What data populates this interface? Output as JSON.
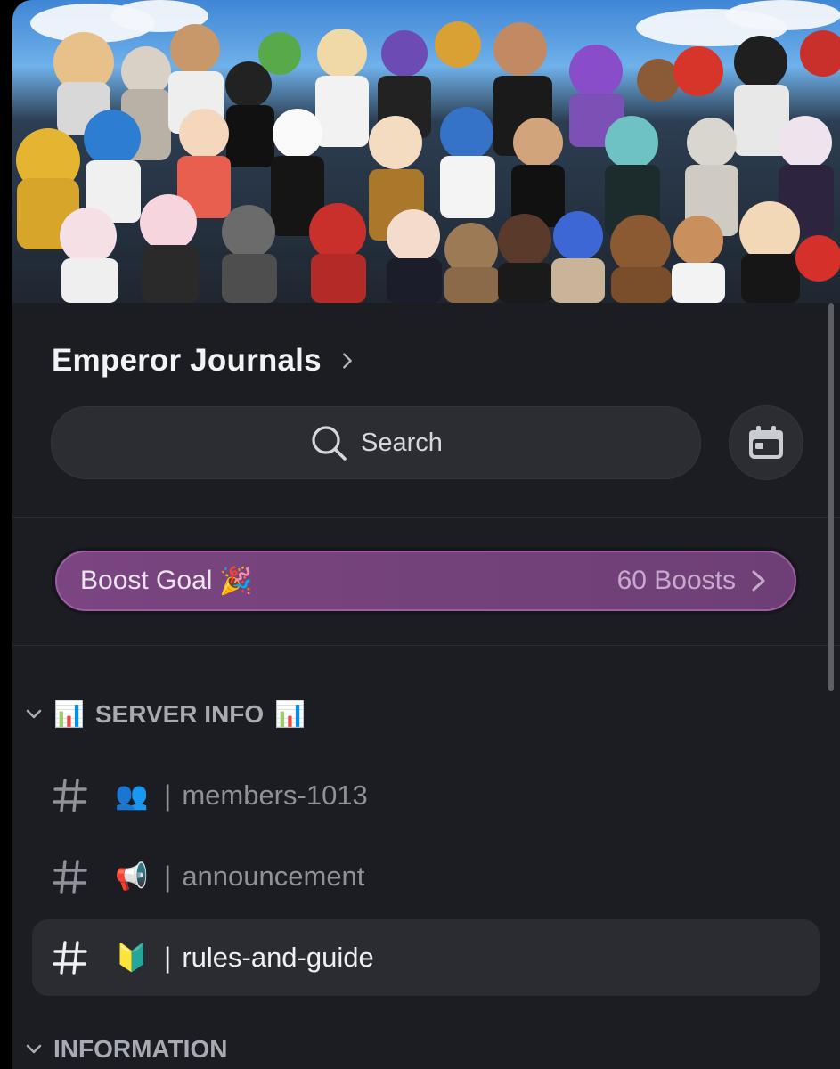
{
  "server": {
    "name": "Emperor Journals"
  },
  "search": {
    "label": "Search"
  },
  "boost": {
    "label": "Boost Goal",
    "emoji": "🎉",
    "count_label": "60 Boosts"
  },
  "categories": [
    {
      "name": "SERVER INFO",
      "emoji": "📊",
      "expanded": true,
      "channels": [
        {
          "emoji": "👥",
          "name": "members-1013",
          "selected": false
        },
        {
          "emoji": "📢",
          "name": "announcement",
          "selected": false
        },
        {
          "emoji": "🔰",
          "name": "rules-and-guide",
          "selected": true
        }
      ]
    },
    {
      "name": "INFORMATION",
      "expanded": true
    }
  ],
  "separator": "|",
  "colors": {
    "boost_accent": "#7a4580",
    "background": "#1c1d22",
    "selected_row": "#2a2c32"
  }
}
